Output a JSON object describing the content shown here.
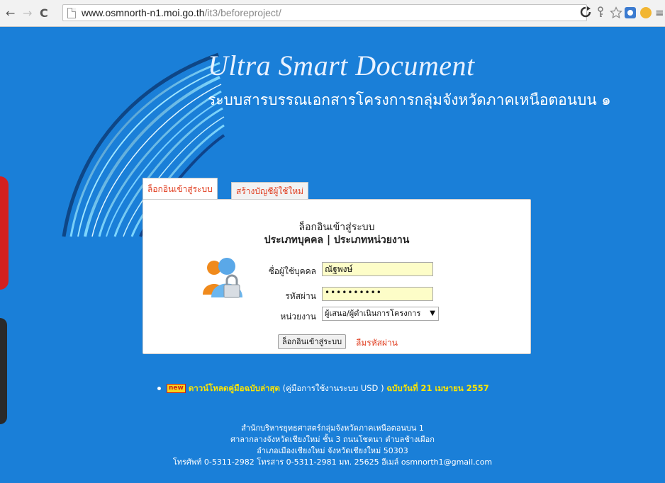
{
  "browser": {
    "back": "←",
    "forward": "→",
    "reload": "C",
    "url_host": "www.osmnorth-n1.moi.go.th",
    "url_path": "/it3/beforeproject/",
    "menu": "≡"
  },
  "header": {
    "title_en": "Ultra Smart Document",
    "title_th": "ระบบสารบรรณเอกสารโครงการกลุ่มจังหวัดภาคเหนือตอนบน ๑"
  },
  "tabs": {
    "login": "ล็อกอินเข้าสู่ระบบ",
    "register": "สร้างบัญชีผู้ใช้ใหม่"
  },
  "login": {
    "title": "ล็อกอินเข้าสู่ระบบ",
    "subtitle": "ประเภทบุคคล | ประเภทหน่วยงาน",
    "username_label": "ชื่อผู้ใช้บุคคล",
    "username_value": "ณัฐพงษ์",
    "password_label": "รหัสผ่าน",
    "password_value": "••••••••••",
    "unit_label": "หน่วยงาน",
    "unit_value": "ผู้เสนอ/ผู้ดำเนินการโครงการ",
    "submit": "ล็อกอินเข้าสู่ระบบ",
    "forgot": "ลืมรหัสผ่าน"
  },
  "download": {
    "badge": "new",
    "link_text": "ดาวน์โหลดคู่มือฉบับล่าสุด",
    "desc": "(คู่มือการใช้งานระบบ USD )",
    "date": "ฉบับวันที่ 21 เมษายน 2557"
  },
  "footer": {
    "line1": "สำนักบริหารยุทธศาสตร์กลุ่มจังหวัดภาคเหนือตอนบน 1",
    "line2": "ศาลากลางจังหวัดเชียงใหม่ ชั้น 3 ถนนโชตนา ตำบลช้างเผือก",
    "line3": "อำเภอเมืองเชียงใหม่ จังหวัดเชียงใหม่ 50303",
    "line4": "โทรศัพท์ 0-5311-2982 โทรสาร 0-5311-2981 มท. 25625 อีเมล์ osmnorth1@gmail.com"
  },
  "colors": {
    "page_bg": "#1a7fd8",
    "accent_red": "#e03c1e",
    "field_bg": "#fdfdc8",
    "highlight_yellow": "#ffe600"
  }
}
